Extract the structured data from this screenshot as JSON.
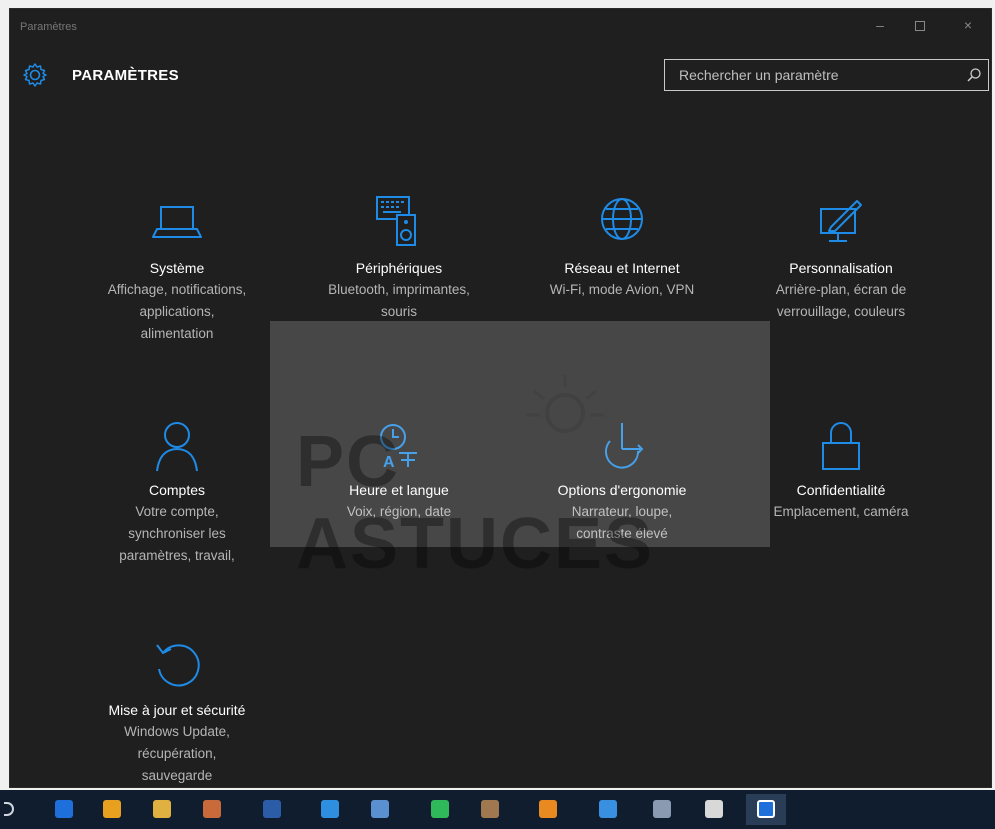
{
  "window": {
    "title": "Paramètres"
  },
  "header": {
    "title": "PARAMÈTRES",
    "search_placeholder": "Rechercher un paramètre"
  },
  "tiles": [
    {
      "name": "Système",
      "desc": [
        "Affichage, notifications,",
        "applications,",
        "alimentation"
      ],
      "icon": "laptop-icon"
    },
    {
      "name": "Périphériques",
      "desc": [
        "Bluetooth, imprimantes,",
        "souris"
      ],
      "icon": "devices-icon"
    },
    {
      "name": "Réseau et Internet",
      "desc": [
        "Wi-Fi, mode Avion, VPN"
      ],
      "icon": "globe-icon"
    },
    {
      "name": "Personnalisation",
      "desc": [
        "Arrière-plan, écran de",
        "verrouillage, couleurs"
      ],
      "icon": "paint-icon"
    },
    {
      "name": "Comptes",
      "desc": [
        "Votre compte,",
        "synchroniser les",
        "paramètres, travail,"
      ],
      "icon": "user-icon"
    },
    {
      "name": "Heure et langue",
      "desc": [
        "Voix, région, date"
      ],
      "icon": "clock-language-icon"
    },
    {
      "name": "Options d'ergonomie",
      "desc": [
        "Narrateur, loupe,",
        "contraste élevé"
      ],
      "icon": "ease-of-access-icon"
    },
    {
      "name": "Confidentialité",
      "desc": [
        "Emplacement, caméra"
      ],
      "icon": "lock-icon"
    },
    {
      "name": "Mise à jour et sécurité",
      "desc": [
        "Windows Update,",
        "récupération,",
        "sauvegarde"
      ],
      "icon": "update-icon"
    }
  ],
  "watermark": {
    "text": "PC ASTUCES"
  },
  "colors": {
    "accent": "#1e8be6",
    "background": "#1f1f1f",
    "taskbar": "#101d2e"
  },
  "taskbar": {
    "items": [
      {
        "icon": "edge-icon",
        "color": "#1e6fd9"
      },
      {
        "icon": "chrome-icon",
        "color": "#e8a020"
      },
      {
        "icon": "file-explorer-icon",
        "color": "#e0b040"
      },
      {
        "icon": "paint-app-icon",
        "color": "#c86a3a"
      },
      {
        "icon": "word-icon",
        "color": "#2b5ca8"
      },
      {
        "icon": "dropbox-icon",
        "color": "#2e8fe0"
      },
      {
        "icon": "app-icon",
        "color": "#5a8fd0"
      },
      {
        "icon": "spotify-icon",
        "color": "#2fb95a"
      },
      {
        "icon": "media-icon",
        "color": "#a07850"
      },
      {
        "icon": "vlc-icon",
        "color": "#e88a20"
      },
      {
        "icon": "internet-explorer-icon",
        "color": "#3a90e0"
      },
      {
        "icon": "screenshot-icon",
        "color": "#8a9ab0"
      },
      {
        "icon": "box-icon",
        "color": "#d8d8d8"
      },
      {
        "icon": "settings-icon",
        "color": "#ffffff"
      }
    ]
  }
}
